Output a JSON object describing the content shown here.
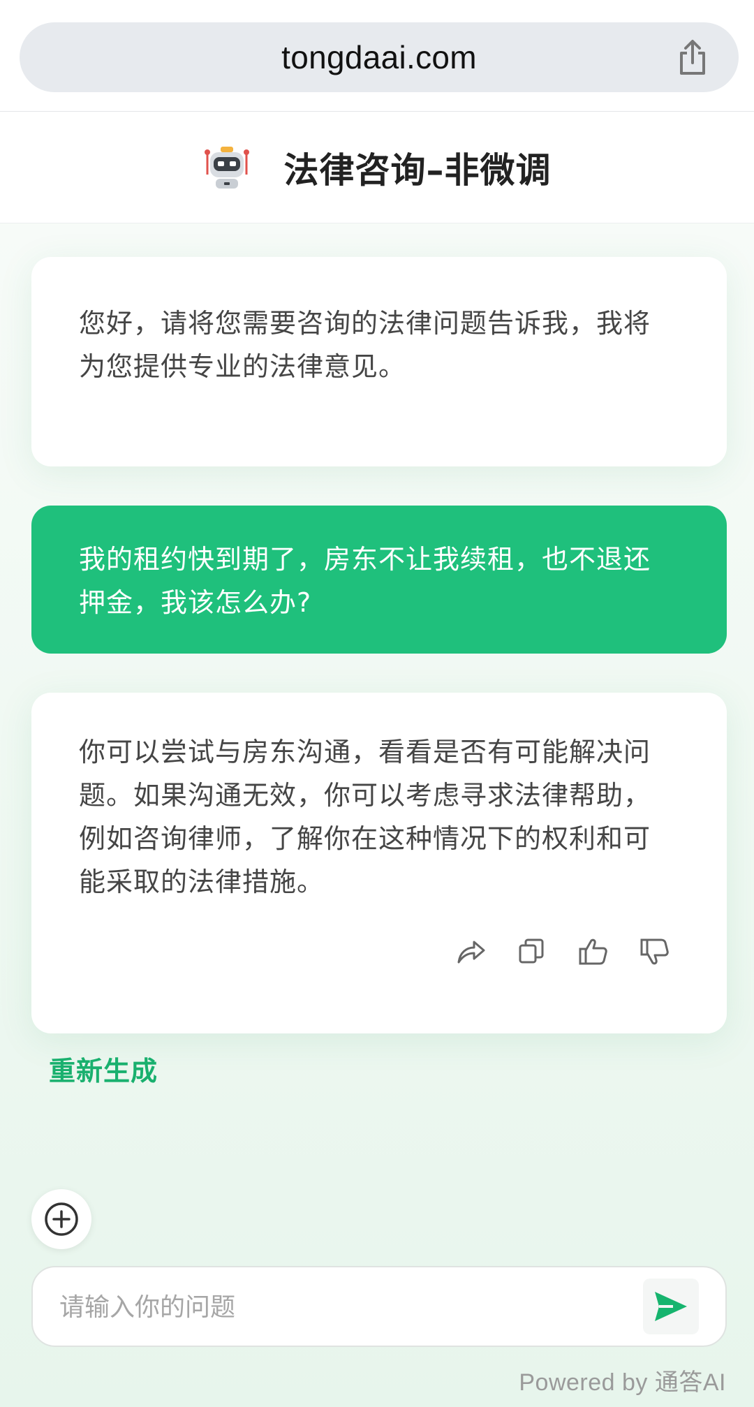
{
  "browser": {
    "url": "tongdaai.com",
    "share_icon": "share-icon"
  },
  "header": {
    "avatar_icon": "robot-icon",
    "title": "法律咨询–非微调"
  },
  "messages": [
    {
      "role": "bot",
      "text": "您好，请将您需要咨询的法律问题告诉我，我将为您提供专业的法律意见。"
    },
    {
      "role": "user",
      "text": "我的租约快到期了，房东不让我续租，也不退还押金，我该怎么办?"
    },
    {
      "role": "bot",
      "text": "你可以尝试与房东沟通，看看是否有可能解决问题。如果沟通无效，你可以考虑寻求法律帮助，例如咨询律师，了解你在这种情况下的权利和可能采取的法律措施。",
      "actions": [
        "share-icon",
        "copy-icon",
        "thumbs-up-icon",
        "thumbs-down-icon"
      ]
    }
  ],
  "regenerate_label": "重新生成",
  "composer": {
    "plus_icon": "plus-circle-icon",
    "placeholder": "请输入你的问题",
    "send_icon": "send-icon"
  },
  "footer": {
    "powered_by": "Powered by 通答AI"
  },
  "colors": {
    "accent": "#1fc07c",
    "regenerate": "#19b06e",
    "send_arrow": "#16b46e"
  }
}
